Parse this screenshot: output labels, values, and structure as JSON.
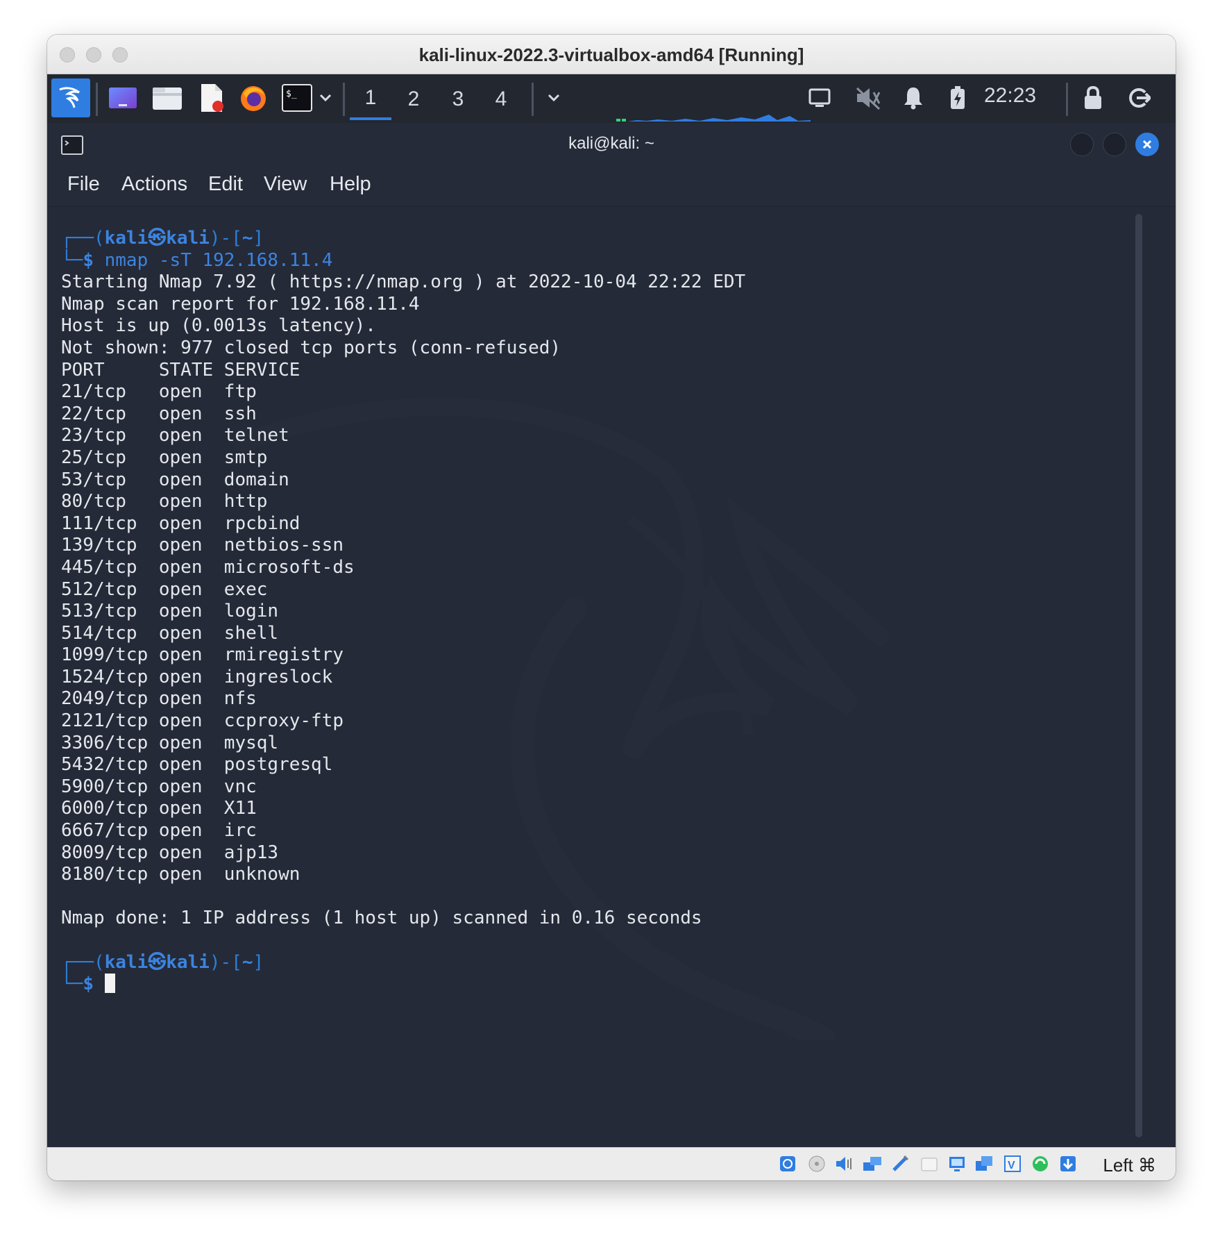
{
  "window": {
    "title": "kali-linux-2022.3-virtualbox-amd64 [Running]"
  },
  "panel": {
    "workspaces": [
      "1",
      "2",
      "3",
      "4"
    ],
    "active_workspace": "1",
    "clock": "22:23"
  },
  "terminal": {
    "title": "kali@kali: ~",
    "menu": [
      "File",
      "Actions",
      "Edit",
      "View",
      "Help"
    ],
    "prompt": {
      "frame_top": "┌──(",
      "user": "kali",
      "at": "㉿",
      "host": "kali",
      "mid": ")-[",
      "dir": "~",
      "end": "]",
      "frame_bottom": "└─",
      "dollar": "$"
    },
    "command": "nmap -sT 192.168.11.4",
    "output": [
      "Starting Nmap 7.92 ( https://nmap.org ) at 2022-10-04 22:22 EDT",
      "Nmap scan report for 192.168.11.4",
      "Host is up (0.0013s latency).",
      "Not shown: 977 closed tcp ports (conn-refused)",
      "PORT     STATE SERVICE",
      "21/tcp   open  ftp",
      "22/tcp   open  ssh",
      "23/tcp   open  telnet",
      "25/tcp   open  smtp",
      "53/tcp   open  domain",
      "80/tcp   open  http",
      "111/tcp  open  rpcbind",
      "139/tcp  open  netbios-ssn",
      "445/tcp  open  microsoft-ds",
      "512/tcp  open  exec",
      "513/tcp  open  login",
      "514/tcp  open  shell",
      "1099/tcp open  rmiregistry",
      "1524/tcp open  ingreslock",
      "2049/tcp open  nfs",
      "2121/tcp open  ccproxy-ftp",
      "3306/tcp open  mysql",
      "5432/tcp open  postgresql",
      "5900/tcp open  vnc",
      "6000/tcp open  X11",
      "6667/tcp open  irc",
      "8009/tcp open  ajp13",
      "8180/tcp open  unknown",
      "",
      "Nmap done: 1 IP address (1 host up) scanned in 0.16 seconds",
      ""
    ]
  },
  "statusbar": {
    "host_key": "Left ⌘"
  },
  "colors": {
    "terminal_bg": "#252a38",
    "panel_bg": "#23272f",
    "prompt_blue": "#3b84e0",
    "accent": "#2f7de1"
  }
}
